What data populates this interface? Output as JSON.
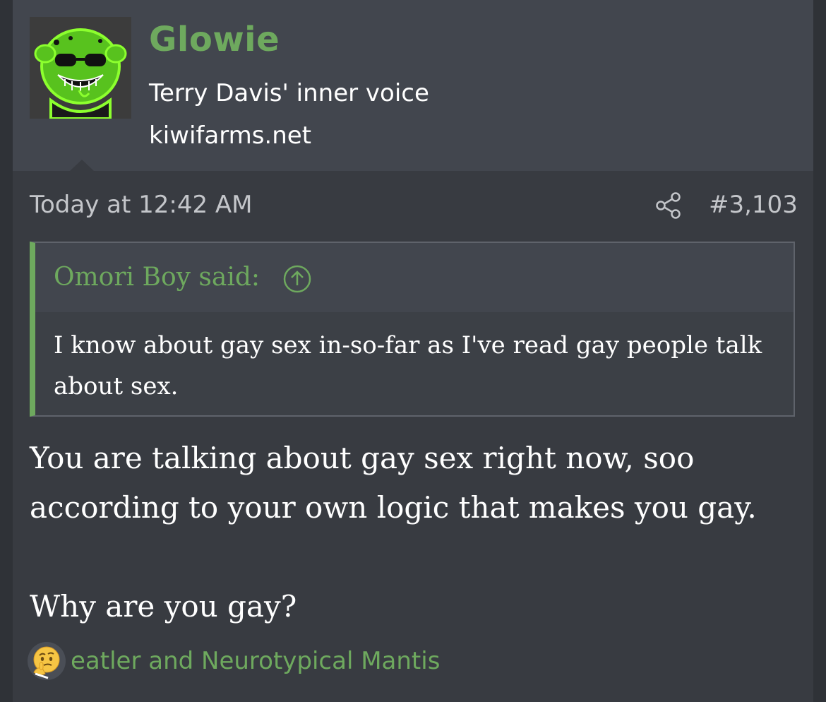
{
  "author": {
    "username": "Glowie",
    "title": "Terry Davis' inner voice",
    "site": "kiwifarms.net",
    "avatar_icon": "glowing-green-character-avatar",
    "username_color": "#6ea95e"
  },
  "post": {
    "date": "Today at 12:42 AM",
    "share_icon": "share-icon",
    "number": "#3,103",
    "quote": {
      "author_label": "Omori Boy said:",
      "expand_icon": "arrow-up-circle-icon",
      "text": "I know about gay sex in-so-far as I've read gay people talk about sex."
    },
    "message": "You are talking about gay sex right now, soo according to your own logic that makes you gay.\n\nWhy are you gay?"
  },
  "reactions": {
    "icon": "thinking-face-icon",
    "text": "eatler and Neurotypical Mantis"
  },
  "colors": {
    "accent": "#6ea95e",
    "header_bg": "#42464e",
    "body_bg": "#383b41"
  }
}
